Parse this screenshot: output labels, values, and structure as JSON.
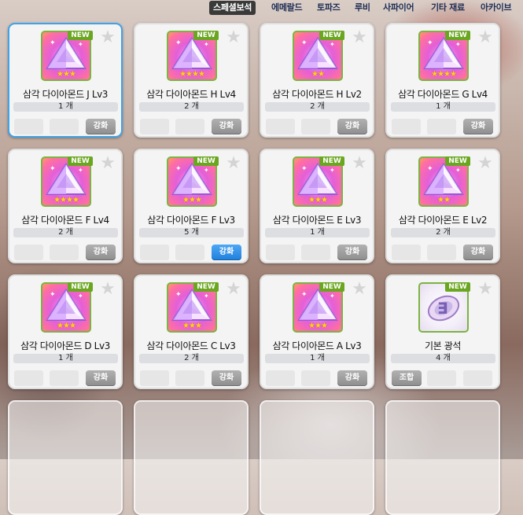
{
  "tabs": [
    {
      "label": "스페셜보석",
      "active": true
    },
    {
      "label": "에메랄드",
      "active": false
    },
    {
      "label": "토파즈",
      "active": false
    },
    {
      "label": "루비",
      "active": false
    },
    {
      "label": "사파이어",
      "active": false
    },
    {
      "label": "기타 재료",
      "active": false
    },
    {
      "label": "아카이브",
      "active": false
    }
  ],
  "new_label": "NEW",
  "items": [
    {
      "name": "삼각 다이아몬드 J Lv3",
      "count": "1 개",
      "button": "강화",
      "stars": 3,
      "icon": "triangle-diamond-icon",
      "selected": true
    },
    {
      "name": "삼각 다이아몬드 H Lv4",
      "count": "2 개",
      "button": "강화",
      "stars": 4,
      "icon": "triangle-diamond-icon"
    },
    {
      "name": "삼각 다이아몬드 H Lv2",
      "count": "2 개",
      "button": "강화",
      "stars": 2,
      "icon": "triangle-diamond-icon"
    },
    {
      "name": "삼각 다이아몬드 G Lv4",
      "count": "1 개",
      "button": "강화",
      "stars": 4,
      "icon": "triangle-diamond-icon"
    },
    {
      "name": "삼각 다이아몬드 F Lv4",
      "count": "2 개",
      "button": "강화",
      "stars": 4,
      "icon": "triangle-diamond-icon"
    },
    {
      "name": "삼각 다이아몬드 F Lv3",
      "count": "5 개",
      "button": "강화",
      "stars": 3,
      "icon": "triangle-diamond-icon",
      "button_color": "#2a8be6"
    },
    {
      "name": "삼각 다이아몬드 E Lv3",
      "count": "1 개",
      "button": "강화",
      "stars": 3,
      "icon": "triangle-diamond-icon"
    },
    {
      "name": "삼각 다이아몬드 E Lv2",
      "count": "2 개",
      "button": "강화",
      "stars": 2,
      "icon": "triangle-diamond-icon"
    },
    {
      "name": "삼각 다이아몬드 D Lv3",
      "count": "1 개",
      "button": "강화",
      "stars": 3,
      "icon": "triangle-diamond-icon"
    },
    {
      "name": "삼각 다이아몬드 C Lv3",
      "count": "2 개",
      "button": "강화",
      "stars": 3,
      "icon": "triangle-diamond-icon"
    },
    {
      "name": "삼각 다이아몬드 A Lv3",
      "count": "1 개",
      "button": "강화",
      "stars": 3,
      "icon": "triangle-diamond-icon"
    },
    {
      "name": "기본 광석",
      "count": "4 개",
      "button": "조합",
      "stars": 0,
      "icon": "basic-ore-icon",
      "button_left": true
    }
  ],
  "colors": {
    "tab_active_bg": "#3a3a3a",
    "tab_text": "#1e2e55",
    "new_badge": "#6aa620",
    "selected_border": "#3fa3e8",
    "button_gray": "#9a9a9a",
    "button_blue": "#2a8be6"
  }
}
